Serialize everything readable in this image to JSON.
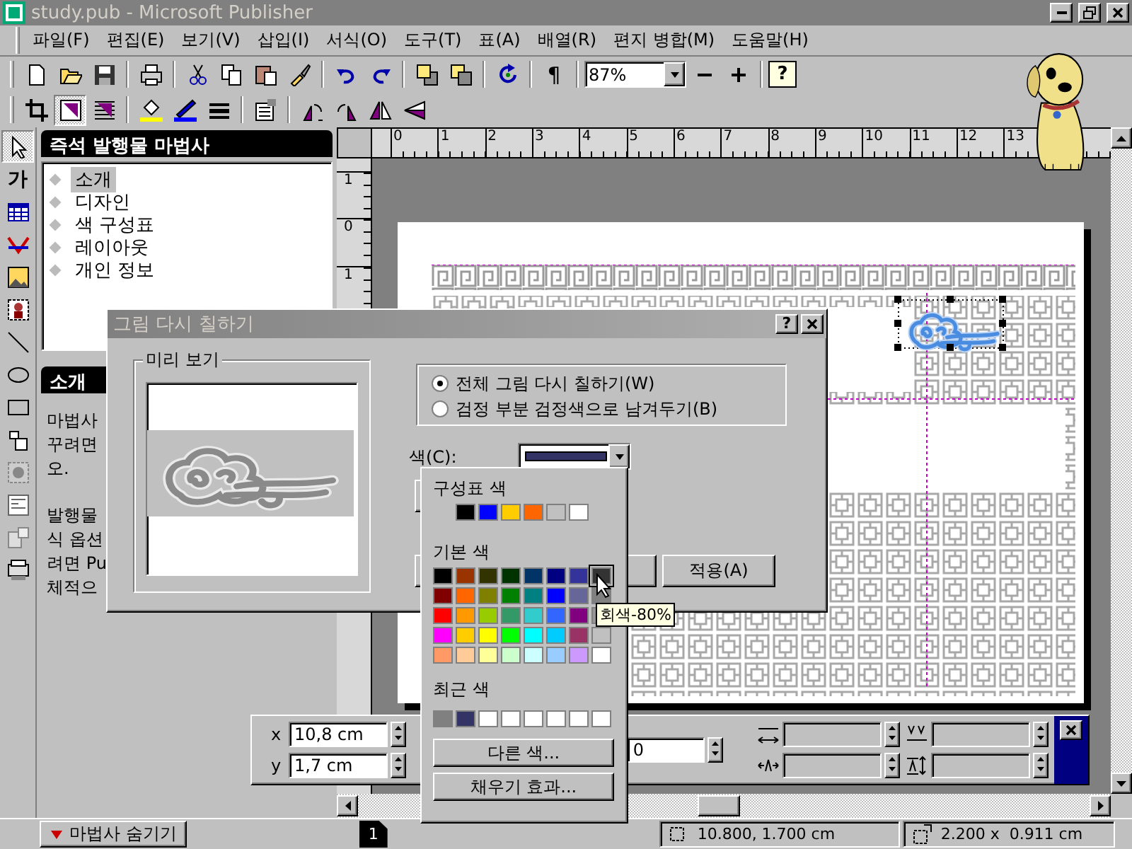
{
  "window": {
    "title": "study.pub - Microsoft Publisher"
  },
  "menu": [
    "파일(F)",
    "편집(E)",
    "보기(V)",
    "삽입(I)",
    "서식(O)",
    "도구(T)",
    "표(A)",
    "배열(R)",
    "편지 병합(M)",
    "도움말(H)"
  ],
  "standard_toolbar": {
    "show_marks_button": "¶",
    "zoom": "87%",
    "help_button": "?"
  },
  "format_toolbar": [
    {
      "pressed": false
    },
    {
      "pressed": true
    },
    {
      "pressed": false
    },
    {
      "pressed": false
    },
    {
      "pressed": false
    },
    {
      "pressed": false
    },
    {
      "pressed": false
    },
    {
      "pressed": false
    },
    {
      "pressed": false
    },
    {
      "pressed": false
    },
    {
      "pressed": false
    }
  ],
  "tools": [
    {
      "pressed": true
    },
    {
      "label": "가",
      "pressed": false
    },
    {
      "pressed": false
    },
    {
      "pressed": false
    },
    {
      "pressed": false
    },
    {
      "pressed": false
    },
    {
      "pressed": false
    },
    {
      "pressed": false
    },
    {
      "pressed": false
    },
    {
      "pressed": false
    },
    {
      "pressed": false
    },
    {
      "pressed": false
    },
    {
      "pressed": false
    },
    {
      "pressed": false
    }
  ],
  "wizard": {
    "title": "즉석 발행물 마법사",
    "items": [
      {
        "label": "소개",
        "selected": true
      },
      {
        "label": "디자인",
        "selected": false
      },
      {
        "label": "색 구성표",
        "selected": false
      },
      {
        "label": "레이아웃",
        "selected": false
      },
      {
        "label": "개인 정보",
        "selected": false
      }
    ]
  },
  "help": {
    "title": "소개",
    "paragraphs": [
      [
        "마법사",
        "꾸려면",
        "오."
      ],
      [
        "발행물",
        "식 옵션",
        "려면 Pu",
        "체적으"
      ]
    ]
  },
  "ruler": {
    "horizontal": [
      "0",
      "1",
      "2",
      "3",
      "4",
      "5",
      "6",
      "7",
      "8",
      "9",
      "10",
      "11",
      "12",
      "13"
    ],
    "vertical": [
      "1",
      "0",
      "1"
    ]
  },
  "measurements": {
    "x_label": "x",
    "x": "10,8 cm",
    "y_label": "y",
    "y": "1,7 cm",
    "field_3": "0"
  },
  "dialog": {
    "title": "그림 다시 칠하기",
    "help_button": "?",
    "preview_label": "미리 보기",
    "options": [
      {
        "label": "전체 그림 다시 칠하기(W)",
        "selected": true
      },
      {
        "label": "검정 부분 검정색으로 남겨두기(B)",
        "selected": false
      }
    ],
    "color_label": "색(C):",
    "color": "#333366",
    "apply_button": "적용(A)"
  },
  "color_menu": {
    "scheme_label": "구성표 색",
    "scheme": [
      {
        "color": "#000000"
      },
      {
        "color": "#0000ff"
      },
      {
        "color": "#ffcc00"
      },
      {
        "color": "#ff6600"
      },
      {
        "color": "#c0c0c0"
      },
      {
        "color": "#ffffff"
      }
    ],
    "basic_label": "기본 색",
    "basic": [
      {
        "color": "#000000",
        "selected": false
      },
      {
        "color": "#993300",
        "selected": false
      },
      {
        "color": "#333300",
        "selected": false
      },
      {
        "color": "#003300",
        "selected": false
      },
      {
        "color": "#003366",
        "selected": false
      },
      {
        "color": "#000080",
        "selected": false
      },
      {
        "color": "#333399",
        "selected": false
      },
      {
        "color": "#333333",
        "selected": true
      },
      {
        "color": "#800000",
        "selected": false
      },
      {
        "color": "#ff6600",
        "selected": false
      },
      {
        "color": "#808000",
        "selected": false
      },
      {
        "color": "#008000",
        "selected": false
      },
      {
        "color": "#008080",
        "selected": false
      },
      {
        "color": "#0000ff",
        "selected": false
      },
      {
        "color": "#666699",
        "selected": false
      },
      {
        "color": "#808080",
        "selected": false
      },
      {
        "color": "#ff0000",
        "selected": false
      },
      {
        "color": "#ff9900",
        "selected": false
      },
      {
        "color": "#99cc00",
        "selected": false
      },
      {
        "color": "#339966",
        "selected": false
      },
      {
        "color": "#33cccc",
        "selected": false
      },
      {
        "color": "#3366ff",
        "selected": false
      },
      {
        "color": "#800080",
        "selected": false
      },
      {
        "color": "#969696",
        "selected": false
      },
      {
        "color": "#ff00ff",
        "selected": false
      },
      {
        "color": "#ffcc00",
        "selected": false
      },
      {
        "color": "#ffff00",
        "selected": false
      },
      {
        "color": "#00ff00",
        "selected": false
      },
      {
        "color": "#00ffff",
        "selected": false
      },
      {
        "color": "#00ccff",
        "selected": false
      },
      {
        "color": "#993366",
        "selected": false
      },
      {
        "color": "#c0c0c0",
        "selected": false
      },
      {
        "color": "#ff9966",
        "selected": false
      },
      {
        "color": "#ffcc99",
        "selected": false
      },
      {
        "color": "#ffff99",
        "selected": false
      },
      {
        "color": "#ccffcc",
        "selected": false
      },
      {
        "color": "#ccffff",
        "selected": false
      },
      {
        "color": "#99ccff",
        "selected": false
      },
      {
        "color": "#cc99ff",
        "selected": false
      },
      {
        "color": "#ffffff",
        "selected": false
      }
    ],
    "recent_label": "최근 색",
    "recent": [
      {
        "color": "#808080"
      },
      {
        "color": "#333366"
      },
      {
        "color": "#ffffff"
      },
      {
        "color": "#ffffff"
      },
      {
        "color": "#ffffff"
      },
      {
        "color": "#ffffff"
      },
      {
        "color": "#ffffff"
      },
      {
        "color": "#ffffff"
      }
    ],
    "more_button": "다른 색...",
    "fill_button": "채우기 효과...",
    "tooltip": "회색-80%"
  },
  "status_bar": {
    "wizard_button": "마법사 숨기기",
    "page": "1",
    "position": "10.800, 1.700 cm",
    "size": "2.200 x  0.911 cm"
  }
}
